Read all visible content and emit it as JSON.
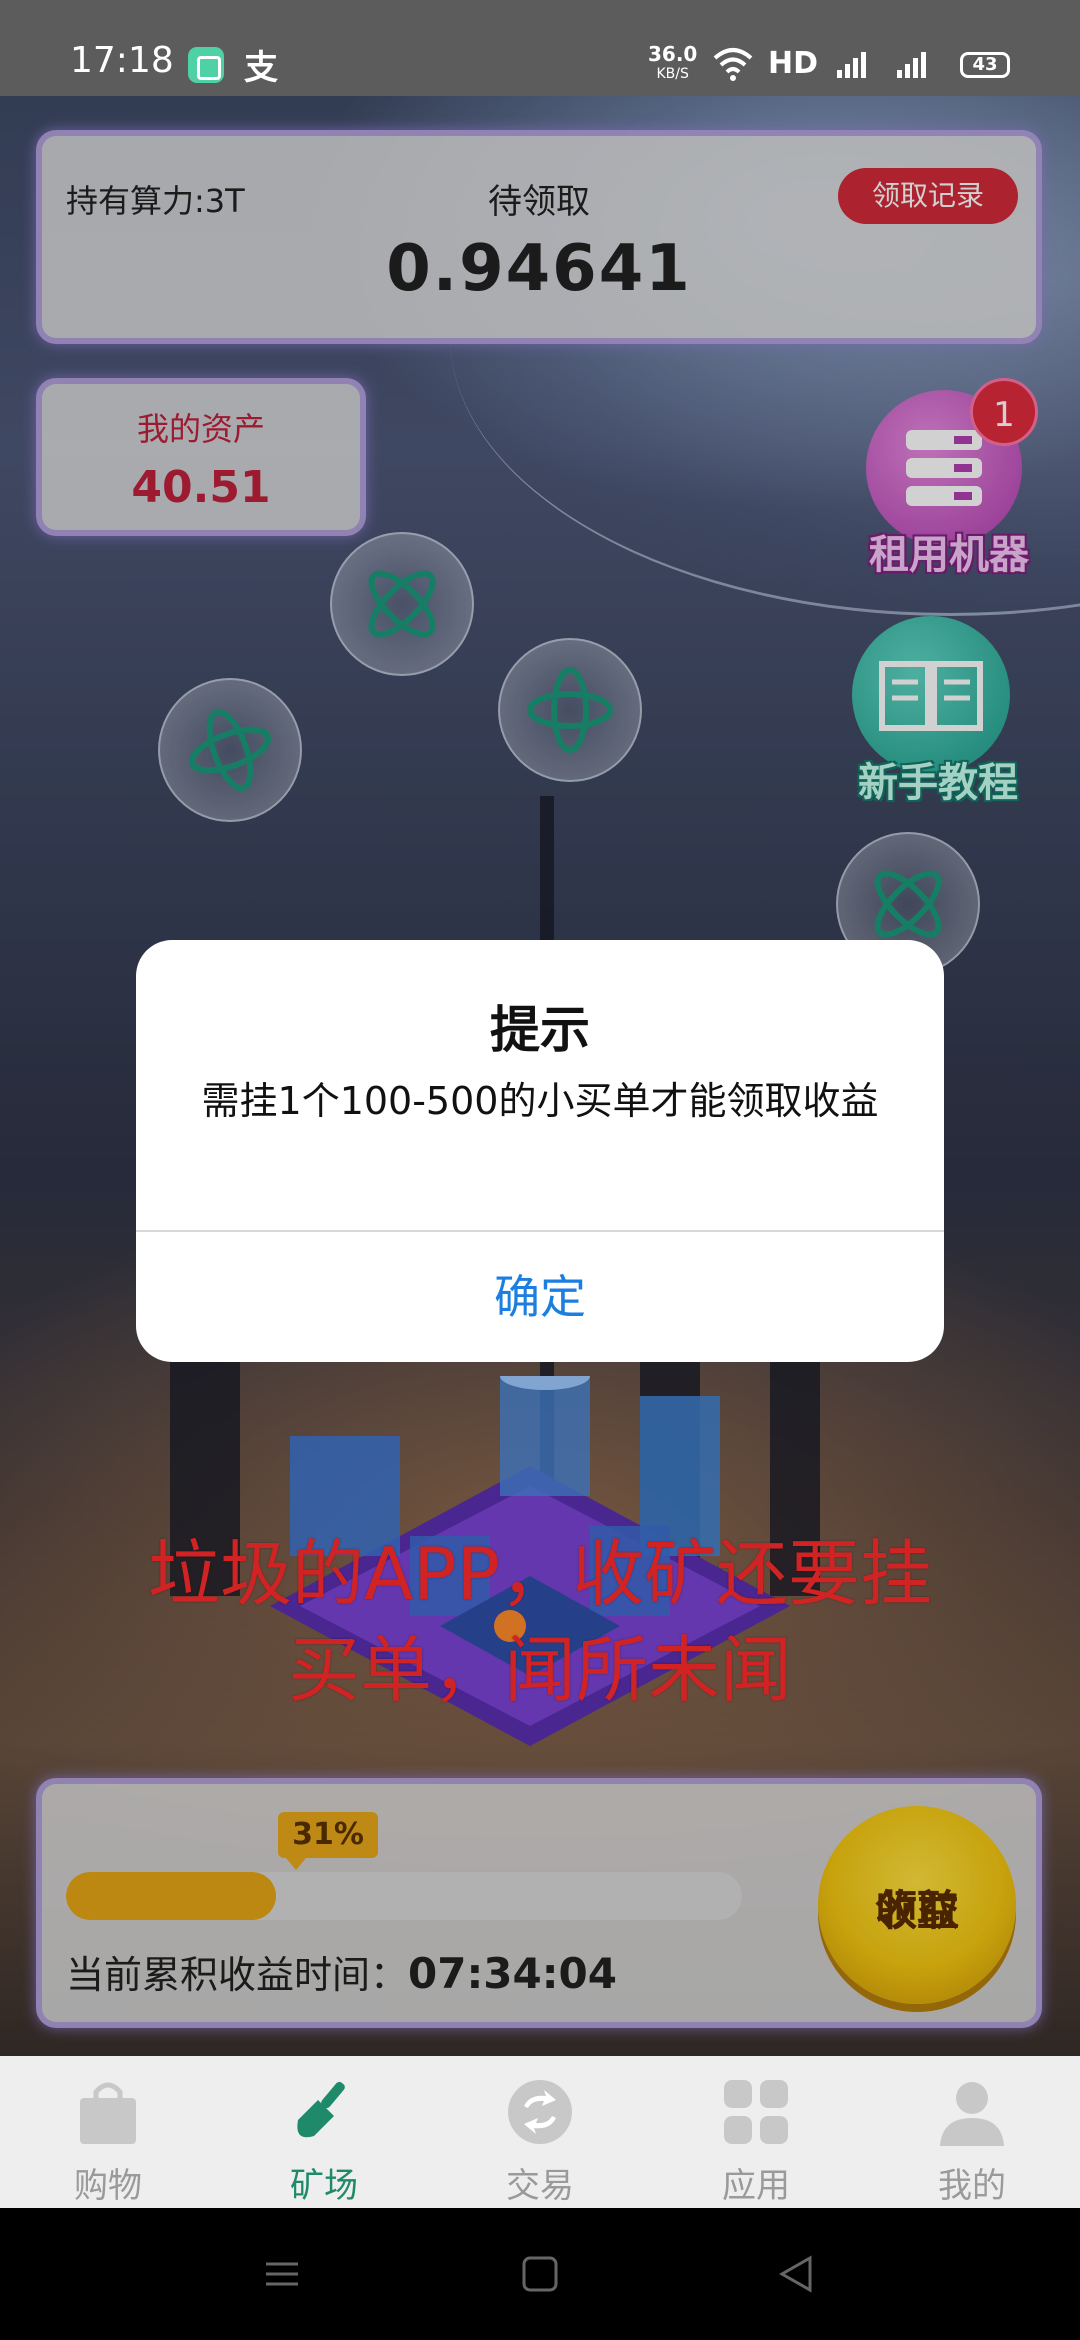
{
  "status_bar": {
    "time": "17:18",
    "speed": "36.0",
    "speed_unit": "KB/S",
    "hd": "HD",
    "battery": "43"
  },
  "mining": {
    "hash_power": "持有算力:3T",
    "pending_label": "待领取",
    "pending_value": "0.94641",
    "record_button": "领取记录"
  },
  "assets": {
    "label": "我的资产",
    "value": "40.51"
  },
  "side_buttons": {
    "rent_label": "租用机器",
    "rent_badge": "1",
    "tutorial_label": "新手教程"
  },
  "overlay_text": {
    "line1": "垃圾的APP，收矿还要挂",
    "line2": "买单，闻所未闻"
  },
  "progress": {
    "percent_label": "31%",
    "percent": 31,
    "timer_label": "当前累积收益时间：",
    "timer_value": "07:34:04",
    "claim_line1": "领取",
    "claim_line2": "收益"
  },
  "nav": {
    "items": [
      {
        "label": "购物",
        "icon": "shopping-bag-icon"
      },
      {
        "label": "矿场",
        "icon": "shovel-icon"
      },
      {
        "label": "交易",
        "icon": "exchange-icon"
      },
      {
        "label": "应用",
        "icon": "apps-grid-icon"
      },
      {
        "label": "我的",
        "icon": "user-icon"
      }
    ],
    "active_index": 1
  },
  "dialog": {
    "title": "提示",
    "message": "需挂1个100-500的小买单才能领取收益",
    "ok_button": "确定"
  },
  "colors": {
    "accent_green": "#1f8a6a",
    "alert_red": "#ff2b2b",
    "dialog_button_blue": "#1c7fe0",
    "progress_gold": "#e6a615"
  }
}
